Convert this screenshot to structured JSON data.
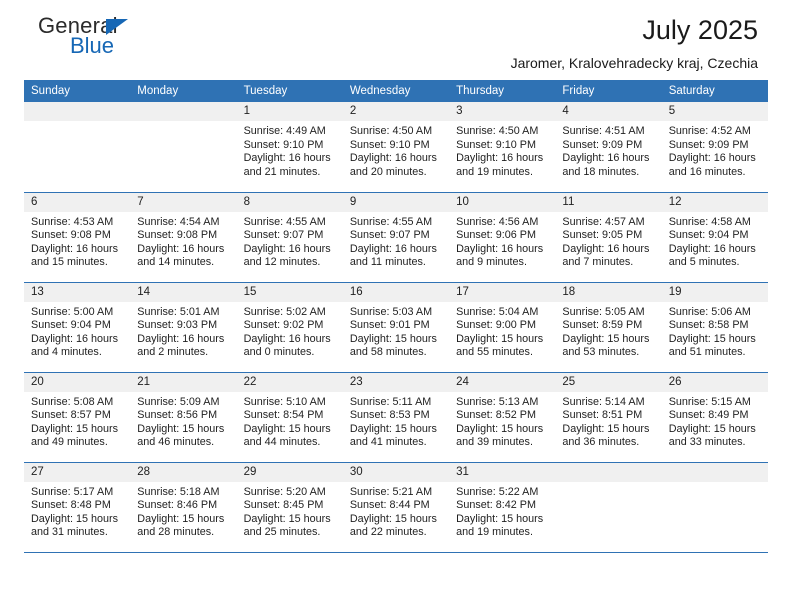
{
  "brand": {
    "name_part1": "General",
    "name_part2": "Blue",
    "triangle_color": "#1667b5"
  },
  "header": {
    "title": "July 2025",
    "subtitle": "Jaromer, Kralovehradecky kraj, Czechia"
  },
  "theme": {
    "header_blue": "#2f72b4",
    "daystrip_gray": "#f0f0f0",
    "text": "#1f1f1f"
  },
  "weekday_headers": [
    "Sunday",
    "Monday",
    "Tuesday",
    "Wednesday",
    "Thursday",
    "Friday",
    "Saturday"
  ],
  "weeks": [
    [
      {
        "day": "",
        "empty": true
      },
      {
        "day": "",
        "empty": true
      },
      {
        "day": "1",
        "sunrise": "Sunrise: 4:49 AM",
        "sunset": "Sunset: 9:10 PM",
        "daylight_line1": "Daylight: 16 hours",
        "daylight_line2": "and 21 minutes."
      },
      {
        "day": "2",
        "sunrise": "Sunrise: 4:50 AM",
        "sunset": "Sunset: 9:10 PM",
        "daylight_line1": "Daylight: 16 hours",
        "daylight_line2": "and 20 minutes."
      },
      {
        "day": "3",
        "sunrise": "Sunrise: 4:50 AM",
        "sunset": "Sunset: 9:10 PM",
        "daylight_line1": "Daylight: 16 hours",
        "daylight_line2": "and 19 minutes."
      },
      {
        "day": "4",
        "sunrise": "Sunrise: 4:51 AM",
        "sunset": "Sunset: 9:09 PM",
        "daylight_line1": "Daylight: 16 hours",
        "daylight_line2": "and 18 minutes."
      },
      {
        "day": "5",
        "sunrise": "Sunrise: 4:52 AM",
        "sunset": "Sunset: 9:09 PM",
        "daylight_line1": "Daylight: 16 hours",
        "daylight_line2": "and 16 minutes."
      }
    ],
    [
      {
        "day": "6",
        "sunrise": "Sunrise: 4:53 AM",
        "sunset": "Sunset: 9:08 PM",
        "daylight_line1": "Daylight: 16 hours",
        "daylight_line2": "and 15 minutes."
      },
      {
        "day": "7",
        "sunrise": "Sunrise: 4:54 AM",
        "sunset": "Sunset: 9:08 PM",
        "daylight_line1": "Daylight: 16 hours",
        "daylight_line2": "and 14 minutes."
      },
      {
        "day": "8",
        "sunrise": "Sunrise: 4:55 AM",
        "sunset": "Sunset: 9:07 PM",
        "daylight_line1": "Daylight: 16 hours",
        "daylight_line2": "and 12 minutes."
      },
      {
        "day": "9",
        "sunrise": "Sunrise: 4:55 AM",
        "sunset": "Sunset: 9:07 PM",
        "daylight_line1": "Daylight: 16 hours",
        "daylight_line2": "and 11 minutes."
      },
      {
        "day": "10",
        "sunrise": "Sunrise: 4:56 AM",
        "sunset": "Sunset: 9:06 PM",
        "daylight_line1": "Daylight: 16 hours",
        "daylight_line2": "and 9 minutes."
      },
      {
        "day": "11",
        "sunrise": "Sunrise: 4:57 AM",
        "sunset": "Sunset: 9:05 PM",
        "daylight_line1": "Daylight: 16 hours",
        "daylight_line2": "and 7 minutes."
      },
      {
        "day": "12",
        "sunrise": "Sunrise: 4:58 AM",
        "sunset": "Sunset: 9:04 PM",
        "daylight_line1": "Daylight: 16 hours",
        "daylight_line2": "and 5 minutes."
      }
    ],
    [
      {
        "day": "13",
        "sunrise": "Sunrise: 5:00 AM",
        "sunset": "Sunset: 9:04 PM",
        "daylight_line1": "Daylight: 16 hours",
        "daylight_line2": "and 4 minutes."
      },
      {
        "day": "14",
        "sunrise": "Sunrise: 5:01 AM",
        "sunset": "Sunset: 9:03 PM",
        "daylight_line1": "Daylight: 16 hours",
        "daylight_line2": "and 2 minutes."
      },
      {
        "day": "15",
        "sunrise": "Sunrise: 5:02 AM",
        "sunset": "Sunset: 9:02 PM",
        "daylight_line1": "Daylight: 16 hours",
        "daylight_line2": "and 0 minutes."
      },
      {
        "day": "16",
        "sunrise": "Sunrise: 5:03 AM",
        "sunset": "Sunset: 9:01 PM",
        "daylight_line1": "Daylight: 15 hours",
        "daylight_line2": "and 58 minutes."
      },
      {
        "day": "17",
        "sunrise": "Sunrise: 5:04 AM",
        "sunset": "Sunset: 9:00 PM",
        "daylight_line1": "Daylight: 15 hours",
        "daylight_line2": "and 55 minutes."
      },
      {
        "day": "18",
        "sunrise": "Sunrise: 5:05 AM",
        "sunset": "Sunset: 8:59 PM",
        "daylight_line1": "Daylight: 15 hours",
        "daylight_line2": "and 53 minutes."
      },
      {
        "day": "19",
        "sunrise": "Sunrise: 5:06 AM",
        "sunset": "Sunset: 8:58 PM",
        "daylight_line1": "Daylight: 15 hours",
        "daylight_line2": "and 51 minutes."
      }
    ],
    [
      {
        "day": "20",
        "sunrise": "Sunrise: 5:08 AM",
        "sunset": "Sunset: 8:57 PM",
        "daylight_line1": "Daylight: 15 hours",
        "daylight_line2": "and 49 minutes."
      },
      {
        "day": "21",
        "sunrise": "Sunrise: 5:09 AM",
        "sunset": "Sunset: 8:56 PM",
        "daylight_line1": "Daylight: 15 hours",
        "daylight_line2": "and 46 minutes."
      },
      {
        "day": "22",
        "sunrise": "Sunrise: 5:10 AM",
        "sunset": "Sunset: 8:54 PM",
        "daylight_line1": "Daylight: 15 hours",
        "daylight_line2": "and 44 minutes."
      },
      {
        "day": "23",
        "sunrise": "Sunrise: 5:11 AM",
        "sunset": "Sunset: 8:53 PM",
        "daylight_line1": "Daylight: 15 hours",
        "daylight_line2": "and 41 minutes."
      },
      {
        "day": "24",
        "sunrise": "Sunrise: 5:13 AM",
        "sunset": "Sunset: 8:52 PM",
        "daylight_line1": "Daylight: 15 hours",
        "daylight_line2": "and 39 minutes."
      },
      {
        "day": "25",
        "sunrise": "Sunrise: 5:14 AM",
        "sunset": "Sunset: 8:51 PM",
        "daylight_line1": "Daylight: 15 hours",
        "daylight_line2": "and 36 minutes."
      },
      {
        "day": "26",
        "sunrise": "Sunrise: 5:15 AM",
        "sunset": "Sunset: 8:49 PM",
        "daylight_line1": "Daylight: 15 hours",
        "daylight_line2": "and 33 minutes."
      }
    ],
    [
      {
        "day": "27",
        "sunrise": "Sunrise: 5:17 AM",
        "sunset": "Sunset: 8:48 PM",
        "daylight_line1": "Daylight: 15 hours",
        "daylight_line2": "and 31 minutes."
      },
      {
        "day": "28",
        "sunrise": "Sunrise: 5:18 AM",
        "sunset": "Sunset: 8:46 PM",
        "daylight_line1": "Daylight: 15 hours",
        "daylight_line2": "and 28 minutes."
      },
      {
        "day": "29",
        "sunrise": "Sunrise: 5:20 AM",
        "sunset": "Sunset: 8:45 PM",
        "daylight_line1": "Daylight: 15 hours",
        "daylight_line2": "and 25 minutes."
      },
      {
        "day": "30",
        "sunrise": "Sunrise: 5:21 AM",
        "sunset": "Sunset: 8:44 PM",
        "daylight_line1": "Daylight: 15 hours",
        "daylight_line2": "and 22 minutes."
      },
      {
        "day": "31",
        "sunrise": "Sunrise: 5:22 AM",
        "sunset": "Sunset: 8:42 PM",
        "daylight_line1": "Daylight: 15 hours",
        "daylight_line2": "and 19 minutes."
      },
      {
        "day": "",
        "empty": true
      },
      {
        "day": "",
        "empty": true
      }
    ]
  ]
}
